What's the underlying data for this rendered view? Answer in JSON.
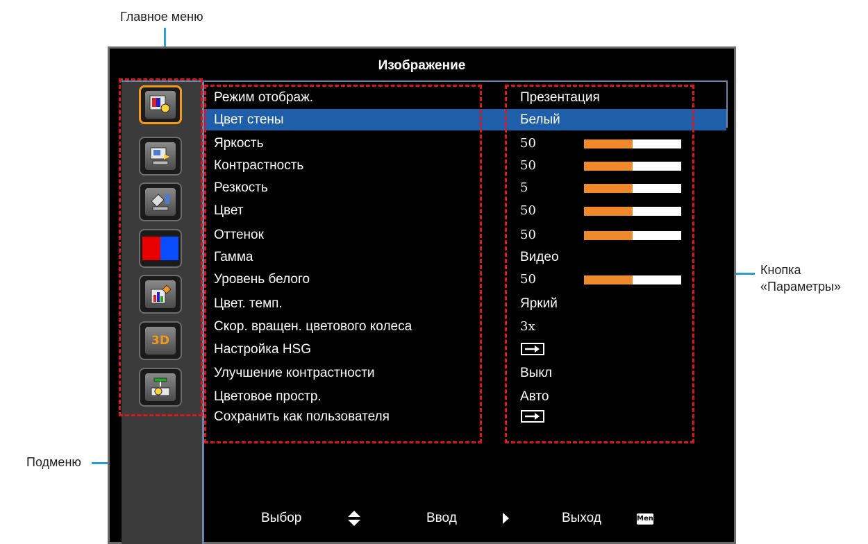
{
  "callouts": {
    "main_menu": "Главное меню",
    "submenu": "Подменю",
    "options_button_line1": "Кнопка",
    "options_button_line2": "«Параметры»"
  },
  "window": {
    "title": "Изображение"
  },
  "sidebar": {
    "items": [
      {
        "icon": "image-settings-icon",
        "active": true
      },
      {
        "icon": "display-settings-icon",
        "active": false
      },
      {
        "icon": "setup-icon",
        "active": false
      },
      {
        "icon": "color-settings-icon",
        "active": false
      },
      {
        "icon": "information-icon",
        "active": false
      },
      {
        "icon": "3d-icon",
        "active": false,
        "text": "3D"
      },
      {
        "icon": "network-icon",
        "active": false
      }
    ]
  },
  "menu": {
    "rows": [
      {
        "label": "Режим отображ.",
        "value": "Презентация"
      },
      {
        "label": "Цвет стены",
        "value": "Белый",
        "highlight": true
      },
      {
        "label": "Яркость",
        "value": "50",
        "slider": 0.5
      },
      {
        "label": "Контрастность",
        "value": "50",
        "slider": 0.5
      },
      {
        "label": "Резкость",
        "value": "5",
        "slider": 0.5
      },
      {
        "label": "Цвет",
        "value": "50",
        "slider": 0.5
      },
      {
        "label": "Оттенок",
        "value": "50",
        "slider": 0.5
      },
      {
        "label": "Гамма",
        "value": "Видео"
      },
      {
        "label": "Уровень белого",
        "value": "50",
        "slider": 0.5
      },
      {
        "label": "Цвет. темп.",
        "value": "Яркий"
      },
      {
        "label": "Скор. вращен. цветового колеса",
        "value": "3x"
      },
      {
        "label": "Настройка HSG",
        "enter": true
      },
      {
        "label": "Улучшение контрастности",
        "value": "Выкл"
      },
      {
        "label": "Цветовое простр.",
        "value": "Авто"
      },
      {
        "label": "Сохранить как пользователя",
        "enter": true
      }
    ]
  },
  "footer": {
    "select_label": "Выбор",
    "enter_label": "Ввод",
    "exit_label": "Выход",
    "menu_badge": "Menu"
  },
  "colors": {
    "highlight": "#1f5ea8",
    "slider_fill": "#f0892a",
    "active_border": "#f39a1d",
    "dash": "#e0161c",
    "callout_line": "#2a9fd6"
  }
}
